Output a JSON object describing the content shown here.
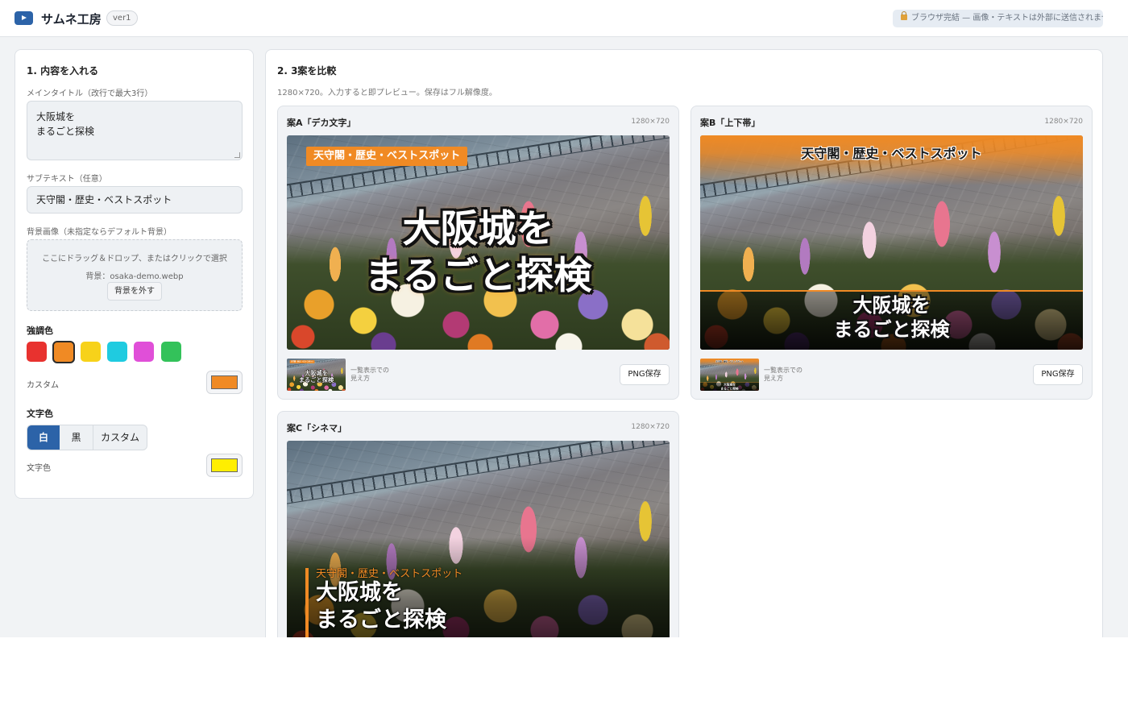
{
  "app": {
    "title": "サムネ工房",
    "version": "ver1",
    "notice": "ブラウザ完結 — 画像・テキストは外部に送信されません"
  },
  "input_panel": {
    "title": "1. 内容を入れる",
    "main_title_label": "メインタイトル（改行で最大3行）",
    "main_title_value": "大阪城を\nまるごと探検",
    "subtext_label": "サブテキスト（任意）",
    "subtext_value": "天守閣・歴史・ベストスポット",
    "bg_label": "背景画像（未指定ならデフォルト背景）",
    "bg_drop_hint": "ここにドラッグ＆ドロップ、またはクリックで選択",
    "bg_file": "背景：osaka-demo.webp",
    "bg_remove": "背景を外す",
    "accent_title": "強調色",
    "accent_swatches": [
      "#e8322f",
      "#f08a24",
      "#f7d21a",
      "#1fcbe0",
      "#e04fd8",
      "#33c25a"
    ],
    "accent_selected": "#f08a24",
    "custom_label": "カスタム",
    "custom_color": "#f08a24",
    "text_color_title": "文字色",
    "text_color_options": [
      "白",
      "黒",
      "カスタム"
    ],
    "text_color_selected": "白",
    "text_color_label": "文字色",
    "text_custom_color": "#ffee00"
  },
  "compare_panel": {
    "title": "2. 3案を比較",
    "description": "1280×720。入力すると即プレビュー。保存はフル解像度。",
    "thumb_caption": "一覧表示での\n見え方",
    "save_label": "PNG保存",
    "designs": [
      {
        "name": "案A「デカ文字」",
        "size": "1280×720"
      },
      {
        "name": "案B「上下帯」",
        "size": "1280×720"
      },
      {
        "name": "案C「シネマ」",
        "size": "1280×720"
      }
    ],
    "preview_main": "大阪城を\nまるごと探検",
    "preview_sub": "天守閣・歴史・ベストスポット"
  }
}
